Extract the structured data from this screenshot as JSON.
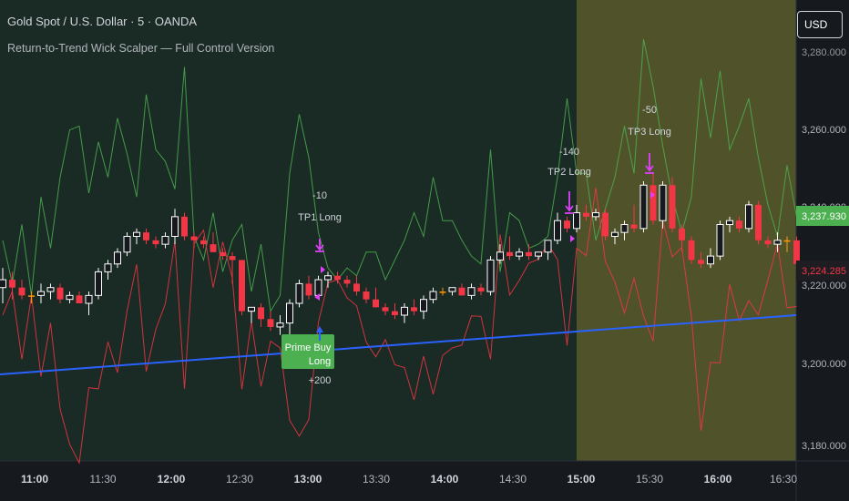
{
  "header": {
    "title": "Gold Spot / U.S. Dollar · 5 · OANDA",
    "indicator": "Return-to-Trend Wick Scalper — Full Control Version"
  },
  "currency_button": "USD",
  "price_axis": {
    "ticks": [
      "3,280.000",
      "3,260.000",
      "3,240.000",
      "3,220.000",
      "3,200.000",
      "3,180.000"
    ],
    "last_price_green": "3,237.930",
    "last_price_red": "3,224.285"
  },
  "time_axis": {
    "ticks": [
      "11:00",
      "11:30",
      "12:00",
      "12:30",
      "13:00",
      "13:30",
      "14:00",
      "14:30",
      "15:00",
      "15:30",
      "16:00",
      "16:30"
    ]
  },
  "signals": {
    "buy_label": "Prime Buy",
    "long_label": "Long",
    "long_pts": "+200",
    "tp1_pts": "-10",
    "tp1_label": "TP1 Long",
    "tp2_pts": "-140",
    "tp2_label": "TP2 Long",
    "tp3_pts": "-50",
    "tp3_label": "TP3 Long"
  },
  "colors": {
    "background": "#161a1e",
    "session_background": "#5a5b2b",
    "bull_candle": "#ffffff",
    "bear_candle": "#f23645",
    "doji_candle": "#ff9800",
    "upper_band": "#4caf50",
    "lower_band": "#f23645",
    "trend_line": "#2962ff",
    "buy_label_bg": "#4caf50",
    "tp_marker": "#e040fb",
    "last_price_green_bg": "#4caf50",
    "last_price_red_bg": "#1e1e22"
  },
  "chart_data": {
    "type": "candlestick",
    "symbol": "Gold Spot / U.S. Dollar",
    "interval": "5",
    "ylim": [
      3175,
      3292
    ],
    "x_ticks": [
      "11:00",
      "11:30",
      "12:00",
      "12:30",
      "13:00",
      "13:30",
      "14:00",
      "14:30",
      "15:00",
      "15:30",
      "16:00",
      "16:30"
    ],
    "start_time": "10:45",
    "candles": [
      {
        "o": 3219,
        "h": 3224,
        "l": 3215,
        "c": 3221
      },
      {
        "o": 3221,
        "h": 3223,
        "l": 3216,
        "c": 3219
      },
      {
        "o": 3219,
        "h": 3221,
        "l": 3216,
        "c": 3217
      },
      {
        "o": 3217,
        "h": 3218,
        "l": 3215,
        "c": 3217
      },
      {
        "o": 3217,
        "h": 3220,
        "l": 3215,
        "c": 3218
      },
      {
        "o": 3218,
        "h": 3220,
        "l": 3216,
        "c": 3219
      },
      {
        "o": 3219,
        "h": 3220,
        "l": 3215,
        "c": 3216
      },
      {
        "o": 3216,
        "h": 3218,
        "l": 3215,
        "c": 3217
      },
      {
        "o": 3217,
        "h": 3218,
        "l": 3215,
        "c": 3215
      },
      {
        "o": 3215,
        "h": 3218,
        "l": 3212,
        "c": 3217
      },
      {
        "o": 3217,
        "h": 3224,
        "l": 3216,
        "c": 3223
      },
      {
        "o": 3223,
        "h": 3226,
        "l": 3221,
        "c": 3225
      },
      {
        "o": 3225,
        "h": 3229,
        "l": 3224,
        "c": 3228
      },
      {
        "o": 3228,
        "h": 3233,
        "l": 3227,
        "c": 3232
      },
      {
        "o": 3232,
        "h": 3234,
        "l": 3230,
        "c": 3233
      },
      {
        "o": 3233,
        "h": 3234,
        "l": 3230,
        "c": 3231
      },
      {
        "o": 3231,
        "h": 3232,
        "l": 3229,
        "c": 3230
      },
      {
        "o": 3230,
        "h": 3233,
        "l": 3229,
        "c": 3232
      },
      {
        "o": 3232,
        "h": 3239,
        "l": 3230,
        "c": 3237
      },
      {
        "o": 3237,
        "h": 3238,
        "l": 3231,
        "c": 3232
      },
      {
        "o": 3232,
        "h": 3233,
        "l": 3229,
        "c": 3231
      },
      {
        "o": 3231,
        "h": 3232,
        "l": 3229,
        "c": 3230
      },
      {
        "o": 3230,
        "h": 3233,
        "l": 3228,
        "c": 3228
      },
      {
        "o": 3228,
        "h": 3229,
        "l": 3226,
        "c": 3227
      },
      {
        "o": 3227,
        "h": 3228,
        "l": 3220,
        "c": 3226
      },
      {
        "o": 3226,
        "h": 3226,
        "l": 3212,
        "c": 3213
      },
      {
        "o": 3213,
        "h": 3214,
        "l": 3210,
        "c": 3214
      },
      {
        "o": 3214,
        "h": 3215,
        "l": 3209,
        "c": 3211
      },
      {
        "o": 3211,
        "h": 3213,
        "l": 3208,
        "c": 3209
      },
      {
        "o": 3209,
        "h": 3212,
        "l": 3207,
        "c": 3210
      },
      {
        "o": 3210,
        "h": 3216,
        "l": 3207,
        "c": 3215
      },
      {
        "o": 3215,
        "h": 3221,
        "l": 3214,
        "c": 3220
      },
      {
        "o": 3220,
        "h": 3222,
        "l": 3216,
        "c": 3217
      },
      {
        "o": 3217,
        "h": 3222,
        "l": 3216,
        "c": 3221
      },
      {
        "o": 3221,
        "h": 3223,
        "l": 3219,
        "c": 3222
      },
      {
        "o": 3222,
        "h": 3223,
        "l": 3220,
        "c": 3221
      },
      {
        "o": 3221,
        "h": 3222,
        "l": 3219,
        "c": 3220
      },
      {
        "o": 3220,
        "h": 3222,
        "l": 3217,
        "c": 3218
      },
      {
        "o": 3218,
        "h": 3219,
        "l": 3215,
        "c": 3216
      },
      {
        "o": 3216,
        "h": 3219,
        "l": 3214,
        "c": 3214
      },
      {
        "o": 3214,
        "h": 3215,
        "l": 3212,
        "c": 3213
      },
      {
        "o": 3213,
        "h": 3215,
        "l": 3211,
        "c": 3212
      },
      {
        "o": 3212,
        "h": 3215,
        "l": 3210,
        "c": 3214
      },
      {
        "o": 3214,
        "h": 3216,
        "l": 3212,
        "c": 3213
      },
      {
        "o": 3213,
        "h": 3217,
        "l": 3211,
        "c": 3216
      },
      {
        "o": 3216,
        "h": 3219,
        "l": 3215,
        "c": 3218
      },
      {
        "o": 3218,
        "h": 3219,
        "l": 3217,
        "c": 3218
      },
      {
        "o": 3218,
        "h": 3219,
        "l": 3217,
        "c": 3219
      },
      {
        "o": 3219,
        "h": 3220,
        "l": 3217,
        "c": 3217
      },
      {
        "o": 3217,
        "h": 3220,
        "l": 3216,
        "c": 3219
      },
      {
        "o": 3219,
        "h": 3220,
        "l": 3217,
        "c": 3218
      },
      {
        "o": 3218,
        "h": 3227,
        "l": 3217,
        "c": 3226
      },
      {
        "o": 3226,
        "h": 3230,
        "l": 3225,
        "c": 3228
      },
      {
        "o": 3228,
        "h": 3232,
        "l": 3226,
        "c": 3227
      },
      {
        "o": 3227,
        "h": 3229,
        "l": 3226,
        "c": 3228
      },
      {
        "o": 3228,
        "h": 3230,
        "l": 3226,
        "c": 3227
      },
      {
        "o": 3227,
        "h": 3228,
        "l": 3226,
        "c": 3228
      },
      {
        "o": 3228,
        "h": 3231,
        "l": 3226,
        "c": 3231
      },
      {
        "o": 3231,
        "h": 3238,
        "l": 3230,
        "c": 3236
      },
      {
        "o": 3236,
        "h": 3237,
        "l": 3233,
        "c": 3234
      },
      {
        "o": 3234,
        "h": 3240,
        "l": 3233,
        "c": 3238
      },
      {
        "o": 3238,
        "h": 3240,
        "l": 3236,
        "c": 3237
      },
      {
        "o": 3237,
        "h": 3239,
        "l": 3236,
        "c": 3238
      },
      {
        "o": 3238,
        "h": 3239,
        "l": 3231,
        "c": 3232
      },
      {
        "o": 3232,
        "h": 3234,
        "l": 3230,
        "c": 3233
      },
      {
        "o": 3233,
        "h": 3236,
        "l": 3231,
        "c": 3235
      },
      {
        "o": 3235,
        "h": 3240,
        "l": 3233,
        "c": 3234
      },
      {
        "o": 3234,
        "h": 3246,
        "l": 3233,
        "c": 3245
      },
      {
        "o": 3245,
        "h": 3248,
        "l": 3235,
        "c": 3236
      },
      {
        "o": 3236,
        "h": 3246,
        "l": 3234,
        "c": 3245
      },
      {
        "o": 3245,
        "h": 3247,
        "l": 3233,
        "c": 3234
      },
      {
        "o": 3234,
        "h": 3235,
        "l": 3228,
        "c": 3231
      },
      {
        "o": 3231,
        "h": 3232,
        "l": 3225,
        "c": 3226
      },
      {
        "o": 3226,
        "h": 3228,
        "l": 3224,
        "c": 3225
      },
      {
        "o": 3225,
        "h": 3229,
        "l": 3224,
        "c": 3227
      },
      {
        "o": 3227,
        "h": 3236,
        "l": 3226,
        "c": 3235
      },
      {
        "o": 3235,
        "h": 3237,
        "l": 3233,
        "c": 3236
      },
      {
        "o": 3236,
        "h": 3237,
        "l": 3233,
        "c": 3234
      },
      {
        "o": 3234,
        "h": 3241,
        "l": 3233,
        "c": 3240
      },
      {
        "o": 3240,
        "h": 3241,
        "l": 3230,
        "c": 3231
      },
      {
        "o": 3231,
        "h": 3232,
        "l": 3229,
        "c": 3230
      },
      {
        "o": 3230,
        "h": 3233,
        "l": 3228,
        "c": 3231
      },
      {
        "o": 3231,
        "h": 3232,
        "l": 3228,
        "c": 3231
      },
      {
        "o": 3231,
        "h": 3232,
        "l": 3224,
        "c": 3225
      }
    ],
    "upper_band": [
      3231,
      3220,
      3235,
      3217,
      3242,
      3229,
      3247,
      3259,
      3260,
      3243,
      3256,
      3247,
      3262,
      3253,
      3242,
      3268,
      3254,
      3251,
      3244,
      3275,
      3232,
      3226,
      3238,
      3223,
      3231,
      3235,
      3218,
      3230,
      3213,
      3217,
      3248,
      3263,
      3252,
      3233,
      3224,
      3221,
      3224,
      3222,
      3228,
      3228,
      3221,
      3226,
      3231,
      3238,
      3232,
      3247,
      3236,
      3236,
      3231,
      3227,
      3225,
      3254,
      3223,
      3238,
      3236,
      3229,
      3230,
      3232,
      3247,
      3267,
      3248,
      3248,
      3231,
      3239,
      3247,
      3260,
      3248,
      3282,
      3270,
      3255,
      3242,
      3233,
      3242,
      3272,
      3257,
      3274,
      3254,
      3260,
      3267,
      3252,
      3240,
      3232,
      3250,
      3237
    ]
  }
}
